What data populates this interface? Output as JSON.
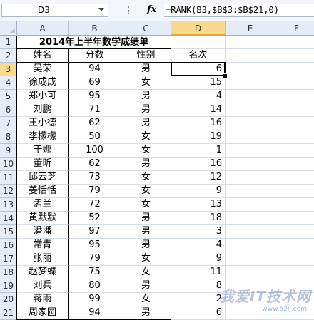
{
  "formula_bar": {
    "name_box": "D3",
    "fx_symbol": "fx",
    "formula": "=RANK(B3,$B$3:$B$21,0)"
  },
  "columns": [
    "A",
    "B",
    "C",
    "D",
    "E",
    "F"
  ],
  "selected_cell": "D3",
  "sheet": {
    "title": "2014年上半年数学成绩单",
    "headers": {
      "name": "姓名",
      "score": "分数",
      "gender": "性别",
      "rank": "名次"
    },
    "rows": [
      {
        "row": "3",
        "name": "吴荣",
        "score": "94",
        "gender": "男",
        "rank": "6"
      },
      {
        "row": "4",
        "name": "徐成成",
        "score": "69",
        "gender": "女",
        "rank": "15"
      },
      {
        "row": "5",
        "name": "郑小可",
        "score": "95",
        "gender": "男",
        "rank": "4"
      },
      {
        "row": "6",
        "name": "刘鹏",
        "score": "71",
        "gender": "男",
        "rank": "14"
      },
      {
        "row": "7",
        "name": "王小德",
        "score": "62",
        "gender": "男",
        "rank": "16"
      },
      {
        "row": "8",
        "name": "李檬檬",
        "score": "50",
        "gender": "女",
        "rank": "19"
      },
      {
        "row": "9",
        "name": "于娜",
        "score": "100",
        "gender": "女",
        "rank": "1"
      },
      {
        "row": "10",
        "name": "董昕",
        "score": "62",
        "gender": "男",
        "rank": "16"
      },
      {
        "row": "11",
        "name": "邱云芝",
        "score": "73",
        "gender": "女",
        "rank": "12"
      },
      {
        "row": "12",
        "name": "姜恬恬",
        "score": "79",
        "gender": "女",
        "rank": "9"
      },
      {
        "row": "13",
        "name": "孟兰",
        "score": "72",
        "gender": "女",
        "rank": "13"
      },
      {
        "row": "14",
        "name": "黄默默",
        "score": "52",
        "gender": "男",
        "rank": "18"
      },
      {
        "row": "15",
        "name": "潘潘",
        "score": "97",
        "gender": "男",
        "rank": "3"
      },
      {
        "row": "16",
        "name": "常青",
        "score": "95",
        "gender": "男",
        "rank": "4"
      },
      {
        "row": "17",
        "name": "张丽",
        "score": "79",
        "gender": "女",
        "rank": "9"
      },
      {
        "row": "18",
        "name": "赵梦蝶",
        "score": "75",
        "gender": "女",
        "rank": "11"
      },
      {
        "row": "19",
        "name": "刘兵",
        "score": "80",
        "gender": "男",
        "rank": "8"
      },
      {
        "row": "20",
        "name": "蒋雨",
        "score": "99",
        "gender": "女",
        "rank": "2"
      },
      {
        "row": "21",
        "name": "周家圆",
        "score": "94",
        "gender": "男",
        "rank": "6"
      }
    ]
  },
  "watermark": {
    "text": "我爱IT技术网",
    "url": "www.52ij.com"
  }
}
